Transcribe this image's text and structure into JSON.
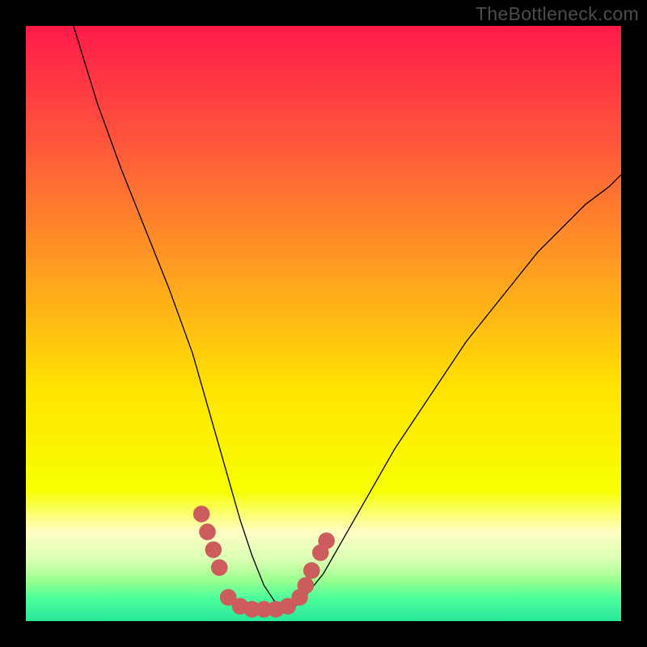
{
  "watermark": "TheBottleneck.com",
  "chart_data": {
    "type": "line",
    "title": "",
    "xlabel": "",
    "ylabel": "",
    "xlim": [
      0,
      100
    ],
    "ylim": [
      0,
      100
    ],
    "gradient_stops": [
      {
        "offset": 0.0,
        "color": "#ff1a4a"
      },
      {
        "offset": 0.2,
        "color": "#ff583b"
      },
      {
        "offset": 0.42,
        "color": "#ffa11f"
      },
      {
        "offset": 0.62,
        "color": "#ffe600"
      },
      {
        "offset": 0.78,
        "color": "#f7ff00"
      },
      {
        "offset": 0.85,
        "color": "#fffec5"
      },
      {
        "offset": 0.9,
        "color": "#d6ffb0"
      },
      {
        "offset": 0.93,
        "color": "#9cff8f"
      },
      {
        "offset": 0.96,
        "color": "#4eff9a"
      },
      {
        "offset": 1.0,
        "color": "#27e89a"
      }
    ],
    "series": [
      {
        "name": "bottleneck-curve",
        "x": [
          8,
          12,
          16,
          20,
          24,
          28,
          30,
          32,
          34,
          36,
          38,
          40,
          42,
          44,
          46,
          50,
          54,
          58,
          62,
          66,
          70,
          74,
          78,
          82,
          86,
          90,
          94,
          98,
          100
        ],
        "y": [
          100,
          87,
          76,
          66,
          56,
          45,
          38,
          31,
          24,
          17,
          11,
          6,
          3,
          2,
          3,
          8,
          15,
          22,
          29,
          35,
          41,
          47,
          52,
          57,
          62,
          66,
          70,
          73,
          75
        ]
      }
    ],
    "markers": {
      "name": "highlight-markers",
      "color": "#cd5c5c",
      "radius": 1.4,
      "points": [
        {
          "x": 29.5,
          "y": 18
        },
        {
          "x": 30.5,
          "y": 15
        },
        {
          "x": 31.5,
          "y": 12
        },
        {
          "x": 32.5,
          "y": 9
        },
        {
          "x": 34.0,
          "y": 4
        },
        {
          "x": 36.0,
          "y": 2.5
        },
        {
          "x": 38.0,
          "y": 2
        },
        {
          "x": 40.0,
          "y": 2
        },
        {
          "x": 42.0,
          "y": 2
        },
        {
          "x": 44.0,
          "y": 2.5
        },
        {
          "x": 46.0,
          "y": 4
        },
        {
          "x": 47.0,
          "y": 6
        },
        {
          "x": 48.0,
          "y": 8.5
        },
        {
          "x": 49.5,
          "y": 11.5
        },
        {
          "x": 50.5,
          "y": 13.5
        }
      ]
    }
  }
}
